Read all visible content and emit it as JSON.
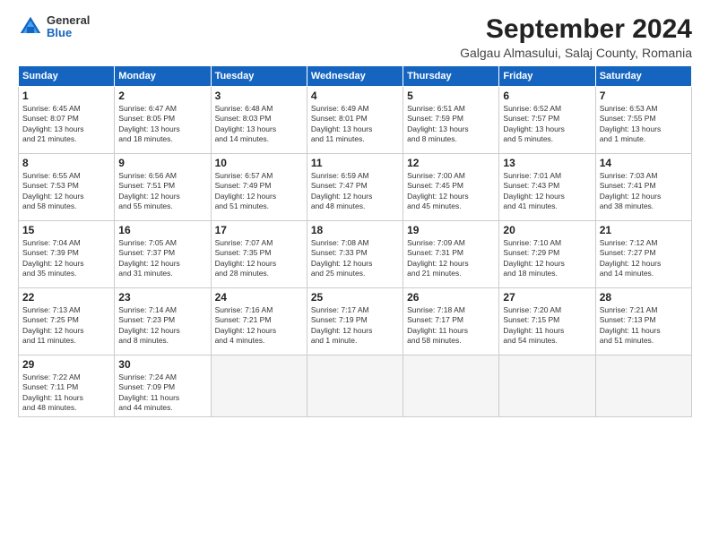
{
  "logo": {
    "general": "General",
    "blue": "Blue"
  },
  "header": {
    "title": "September 2024",
    "subtitle": "Galgau Almasului, Salaj County, Romania"
  },
  "columns": [
    "Sunday",
    "Monday",
    "Tuesday",
    "Wednesday",
    "Thursday",
    "Friday",
    "Saturday"
  ],
  "weeks": [
    [
      {
        "day": "1",
        "info": "Sunrise: 6:45 AM\nSunset: 8:07 PM\nDaylight: 13 hours\nand 21 minutes."
      },
      {
        "day": "2",
        "info": "Sunrise: 6:47 AM\nSunset: 8:05 PM\nDaylight: 13 hours\nand 18 minutes."
      },
      {
        "day": "3",
        "info": "Sunrise: 6:48 AM\nSunset: 8:03 PM\nDaylight: 13 hours\nand 14 minutes."
      },
      {
        "day": "4",
        "info": "Sunrise: 6:49 AM\nSunset: 8:01 PM\nDaylight: 13 hours\nand 11 minutes."
      },
      {
        "day": "5",
        "info": "Sunrise: 6:51 AM\nSunset: 7:59 PM\nDaylight: 13 hours\nand 8 minutes."
      },
      {
        "day": "6",
        "info": "Sunrise: 6:52 AM\nSunset: 7:57 PM\nDaylight: 13 hours\nand 5 minutes."
      },
      {
        "day": "7",
        "info": "Sunrise: 6:53 AM\nSunset: 7:55 PM\nDaylight: 13 hours\nand 1 minute."
      }
    ],
    [
      {
        "day": "8",
        "info": "Sunrise: 6:55 AM\nSunset: 7:53 PM\nDaylight: 12 hours\nand 58 minutes."
      },
      {
        "day": "9",
        "info": "Sunrise: 6:56 AM\nSunset: 7:51 PM\nDaylight: 12 hours\nand 55 minutes."
      },
      {
        "day": "10",
        "info": "Sunrise: 6:57 AM\nSunset: 7:49 PM\nDaylight: 12 hours\nand 51 minutes."
      },
      {
        "day": "11",
        "info": "Sunrise: 6:59 AM\nSunset: 7:47 PM\nDaylight: 12 hours\nand 48 minutes."
      },
      {
        "day": "12",
        "info": "Sunrise: 7:00 AM\nSunset: 7:45 PM\nDaylight: 12 hours\nand 45 minutes."
      },
      {
        "day": "13",
        "info": "Sunrise: 7:01 AM\nSunset: 7:43 PM\nDaylight: 12 hours\nand 41 minutes."
      },
      {
        "day": "14",
        "info": "Sunrise: 7:03 AM\nSunset: 7:41 PM\nDaylight: 12 hours\nand 38 minutes."
      }
    ],
    [
      {
        "day": "15",
        "info": "Sunrise: 7:04 AM\nSunset: 7:39 PM\nDaylight: 12 hours\nand 35 minutes."
      },
      {
        "day": "16",
        "info": "Sunrise: 7:05 AM\nSunset: 7:37 PM\nDaylight: 12 hours\nand 31 minutes."
      },
      {
        "day": "17",
        "info": "Sunrise: 7:07 AM\nSunset: 7:35 PM\nDaylight: 12 hours\nand 28 minutes."
      },
      {
        "day": "18",
        "info": "Sunrise: 7:08 AM\nSunset: 7:33 PM\nDaylight: 12 hours\nand 25 minutes."
      },
      {
        "day": "19",
        "info": "Sunrise: 7:09 AM\nSunset: 7:31 PM\nDaylight: 12 hours\nand 21 minutes."
      },
      {
        "day": "20",
        "info": "Sunrise: 7:10 AM\nSunset: 7:29 PM\nDaylight: 12 hours\nand 18 minutes."
      },
      {
        "day": "21",
        "info": "Sunrise: 7:12 AM\nSunset: 7:27 PM\nDaylight: 12 hours\nand 14 minutes."
      }
    ],
    [
      {
        "day": "22",
        "info": "Sunrise: 7:13 AM\nSunset: 7:25 PM\nDaylight: 12 hours\nand 11 minutes."
      },
      {
        "day": "23",
        "info": "Sunrise: 7:14 AM\nSunset: 7:23 PM\nDaylight: 12 hours\nand 8 minutes."
      },
      {
        "day": "24",
        "info": "Sunrise: 7:16 AM\nSunset: 7:21 PM\nDaylight: 12 hours\nand 4 minutes."
      },
      {
        "day": "25",
        "info": "Sunrise: 7:17 AM\nSunset: 7:19 PM\nDaylight: 12 hours\nand 1 minute."
      },
      {
        "day": "26",
        "info": "Sunrise: 7:18 AM\nSunset: 7:17 PM\nDaylight: 11 hours\nand 58 minutes."
      },
      {
        "day": "27",
        "info": "Sunrise: 7:20 AM\nSunset: 7:15 PM\nDaylight: 11 hours\nand 54 minutes."
      },
      {
        "day": "28",
        "info": "Sunrise: 7:21 AM\nSunset: 7:13 PM\nDaylight: 11 hours\nand 51 minutes."
      }
    ],
    [
      {
        "day": "29",
        "info": "Sunrise: 7:22 AM\nSunset: 7:11 PM\nDaylight: 11 hours\nand 48 minutes."
      },
      {
        "day": "30",
        "info": "Sunrise: 7:24 AM\nSunset: 7:09 PM\nDaylight: 11 hours\nand 44 minutes."
      },
      {
        "day": "",
        "info": ""
      },
      {
        "day": "",
        "info": ""
      },
      {
        "day": "",
        "info": ""
      },
      {
        "day": "",
        "info": ""
      },
      {
        "day": "",
        "info": ""
      }
    ]
  ]
}
